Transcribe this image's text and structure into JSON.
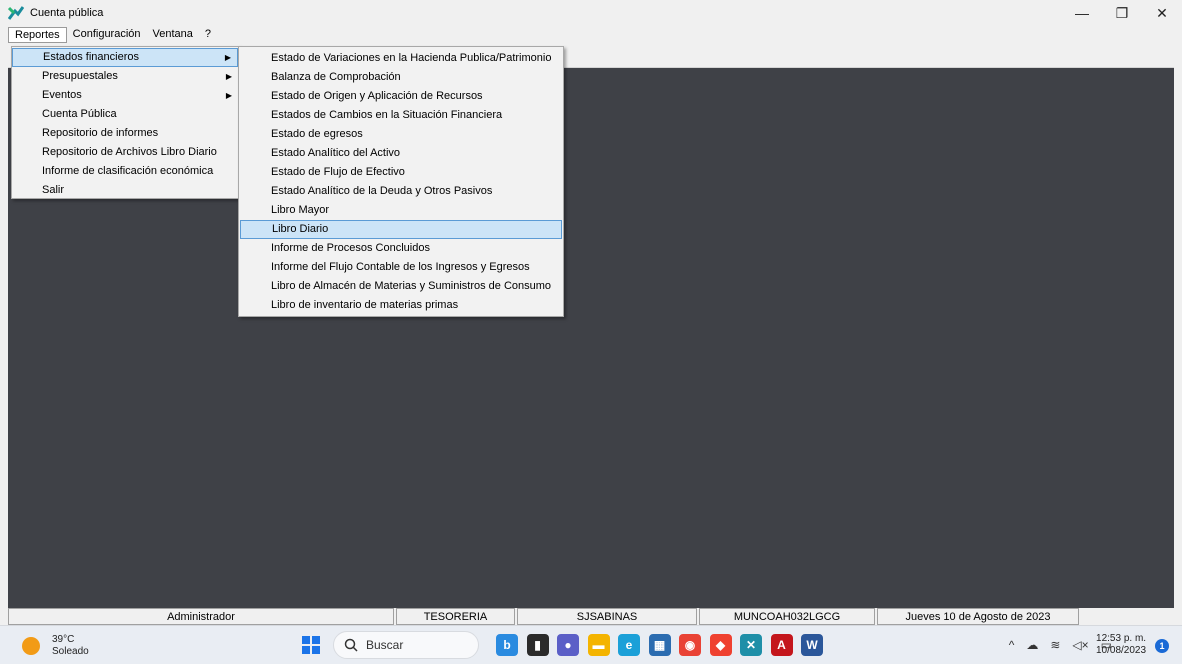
{
  "window": {
    "title": "Cuenta pública",
    "controls": {
      "minimize": "—",
      "restore": "❐",
      "close": "✕"
    }
  },
  "menubar": [
    "Reportes",
    "Configuración",
    "Ventana",
    "?"
  ],
  "reportes_menu": [
    {
      "label": "Estados financieros",
      "submenu": true
    },
    {
      "label": "Presupuestales",
      "submenu": true
    },
    {
      "label": "Eventos",
      "submenu": true
    },
    {
      "label": "Cuenta Pública",
      "submenu": false
    },
    {
      "label": "Repositorio de informes",
      "submenu": false
    },
    {
      "label": "Repositorio de Archivos Libro Diario",
      "submenu": false
    },
    {
      "label": "Informe de clasificación económica",
      "submenu": false
    },
    {
      "label": "Salir",
      "submenu": false
    }
  ],
  "estados_financieros_menu": [
    "Estado de Variaciones en la Hacienda Publica/Patrimonio",
    "Balanza de Comprobación",
    "Estado de Origen y Aplicación de Recursos",
    "Estados de Cambios en la Situación Financiera",
    "Estado de egresos",
    "Estado Analítico del Activo",
    "Estado de Flujo de Efectivo",
    "Estado Analítico de la Deuda y Otros Pasivos",
    "Libro Mayor",
    "Libro Diario",
    "Informe de Procesos Concluidos",
    "Informe del Flujo Contable de los Ingresos y Egresos",
    "Libro de Almacén de Materias y Suministros de Consumo",
    "Libro de inventario de materias primas"
  ],
  "statusbar": [
    "Administrador",
    "TESORERIA MUNICIPAL",
    "SJSABINAS",
    "MUNCOAH032LGCG",
    "Jueves 10 de Agosto de 2023"
  ],
  "taskbar": {
    "weather_temp": "39°C",
    "weather_desc": "Soleado",
    "search_label": "Buscar",
    "time": "12:53 p. m.",
    "date": "10/08/2023",
    "notification_count": "1",
    "apps": [
      {
        "name": "bing-icon",
        "color": "#2a8be0",
        "glyph": "b"
      },
      {
        "name": "task-view-icon",
        "color": "#2b2b2b",
        "glyph": "▮"
      },
      {
        "name": "chat-icon",
        "color": "#5b5fc7",
        "glyph": "●"
      },
      {
        "name": "file-explorer-icon",
        "color": "#f4b400",
        "glyph": "▬"
      },
      {
        "name": "edge-icon",
        "color": "#1ba0d8",
        "glyph": "e"
      },
      {
        "name": "store-icon",
        "color": "#2b6cb0",
        "glyph": "▦"
      },
      {
        "name": "chrome-icon",
        "color": "#e94235",
        "glyph": "◉"
      },
      {
        "name": "anydesk-icon",
        "color": "#ef4130",
        "glyph": "◆"
      },
      {
        "name": "cuenta-publica-icon",
        "color": "#1e8fa8",
        "glyph": "✕"
      },
      {
        "name": "acrobat-icon",
        "color": "#c4161c",
        "glyph": "A"
      },
      {
        "name": "word-icon",
        "color": "#2b579a",
        "glyph": "W"
      }
    ],
    "tray_icons": [
      "^",
      "☁",
      "≋",
      "◁×",
      "▭"
    ]
  },
  "colors": {
    "mdi_background": "#3f4147",
    "menu_highlight": "#cce4f7",
    "menu_highlight_border": "#5b9bd5"
  }
}
